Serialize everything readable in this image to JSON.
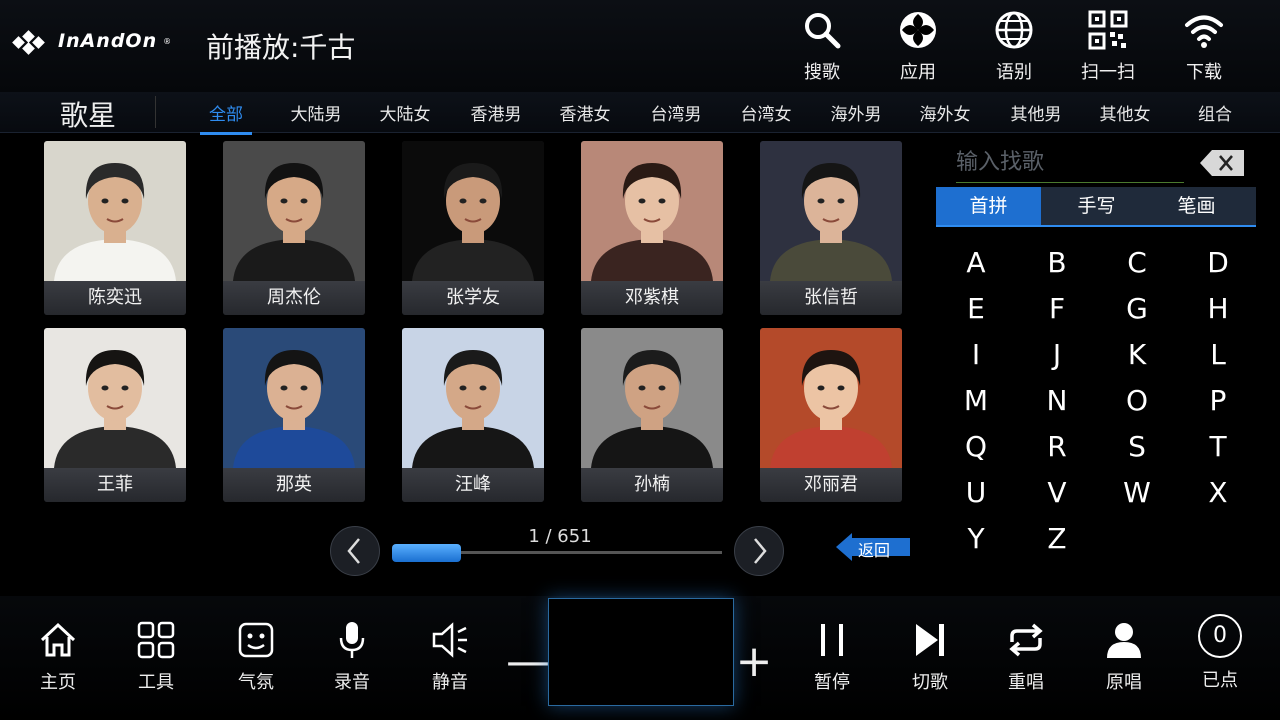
{
  "header": {
    "brand": "InAndOn",
    "brand_mark": "®",
    "now_playing": "前播放:千古",
    "tools": [
      {
        "label": "搜歌",
        "icon": "search-icon"
      },
      {
        "label": "应用",
        "icon": "apps-icon"
      },
      {
        "label": "语别",
        "icon": "globe-icon"
      },
      {
        "label": "扫一扫",
        "icon": "qr-code-icon"
      },
      {
        "label": "下载",
        "icon": "wifi-icon"
      }
    ]
  },
  "category": {
    "title": "歌星",
    "tabs": [
      "全部",
      "大陆男",
      "大陆女",
      "香港男",
      "香港女",
      "台湾男",
      "台湾女",
      "海外男",
      "海外女",
      "其他男",
      "其他女",
      "组合"
    ],
    "active_tab": "全部"
  },
  "singers": [
    {
      "name": "陈奕迅",
      "bg": "#d8d6cc",
      "skin": "#d9b08f",
      "hair": "#2a2a2a",
      "shirt": "#f4f4f0"
    },
    {
      "name": "周杰伦",
      "bg": "#4a4a4a",
      "skin": "#d6a987",
      "hair": "#121212",
      "shirt": "#1a1a1a"
    },
    {
      "name": "张学友",
      "bg": "#0b0b0b",
      "skin": "#c99a7a",
      "hair": "#1a1a1a",
      "shirt": "#222222"
    },
    {
      "name": "邓紫棋",
      "bg": "#b88878",
      "skin": "#e6c0a4",
      "hair": "#2a1a14",
      "shirt": "#3a2420"
    },
    {
      "name": "张信哲",
      "bg": "#2e3140",
      "skin": "#dcb499",
      "hair": "#151515",
      "shirt": "#4a4a3a"
    },
    {
      "name": "王菲",
      "bg": "#e8e6e2",
      "skin": "#e2bd9f",
      "hair": "#161412",
      "shirt": "#2a2a2a"
    },
    {
      "name": "那英",
      "bg": "#2a4a78",
      "skin": "#dbb193",
      "hair": "#141414",
      "shirt": "#1e4a9a"
    },
    {
      "name": "汪峰",
      "bg": "#c8d4e6",
      "skin": "#d4a888",
      "hair": "#1a1a1a",
      "shirt": "#161616"
    },
    {
      "name": "孙楠",
      "bg": "#8a8a8a",
      "skin": "#cfa283",
      "hair": "#1c1c1c",
      "shirt": "#151515"
    },
    {
      "name": "邓丽君",
      "bg": "#b44a2a",
      "skin": "#ecc4a4",
      "hair": "#1e1410",
      "shirt": "#c04030"
    }
  ],
  "pager": {
    "text": "1 / 651",
    "current": 1,
    "total": 651,
    "thumb_fraction": 0.21,
    "back_label": "返回"
  },
  "search": {
    "placeholder": "输入找歌",
    "value": "",
    "ime_tabs": [
      "首拼",
      "手写",
      "笔画"
    ],
    "active_ime": "首拼",
    "letters": [
      "A",
      "B",
      "C",
      "D",
      "E",
      "F",
      "G",
      "H",
      "I",
      "J",
      "K",
      "L",
      "M",
      "N",
      "O",
      "P",
      "Q",
      "R",
      "S",
      "T",
      "U",
      "V",
      "W",
      "X",
      "Y",
      "Z"
    ]
  },
  "bottom": {
    "left": [
      {
        "label": "主页",
        "icon": "home-icon"
      },
      {
        "label": "工具",
        "icon": "tools-grid-icon"
      },
      {
        "label": "气氛",
        "icon": "atmosphere-icon"
      },
      {
        "label": "录音",
        "icon": "microphone-icon"
      },
      {
        "label": "静音",
        "icon": "mute-icon"
      }
    ],
    "volume_down": "—",
    "volume_up": "+",
    "right": [
      {
        "label": "暂停",
        "icon": "pause-icon"
      },
      {
        "label": "切歌",
        "icon": "next-track-icon"
      },
      {
        "label": "重唱",
        "icon": "repeat-icon"
      },
      {
        "label": "原唱",
        "icon": "singer-icon"
      },
      {
        "label": "已点",
        "icon": "queue-count-icon",
        "count": "0"
      }
    ]
  },
  "colors": {
    "accent": "#2f8cf0",
    "background": "#000000",
    "card_label": "#2e3036"
  }
}
